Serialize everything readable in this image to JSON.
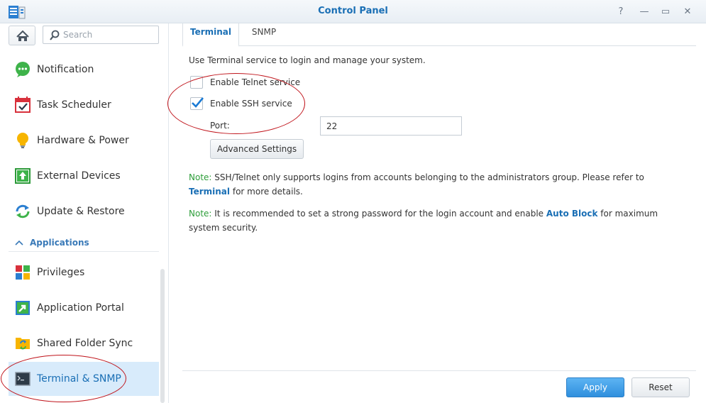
{
  "window": {
    "title": "Control Panel",
    "buttons": [
      {
        "name": "help-icon",
        "glyph": "?"
      },
      {
        "name": "minimize-icon",
        "glyph": "—"
      },
      {
        "name": "maximize-icon",
        "glyph": "▭"
      },
      {
        "name": "close-icon",
        "glyph": "✕"
      }
    ]
  },
  "sidebar": {
    "search_placeholder": "Search",
    "items": [
      {
        "label": "Notification",
        "icon": "notification-icon",
        "active": false
      },
      {
        "label": "Task Scheduler",
        "icon": "task-scheduler-icon",
        "active": false
      },
      {
        "label": "Hardware & Power",
        "icon": "lightbulb-icon",
        "active": false
      },
      {
        "label": "External Devices",
        "icon": "external-device-icon",
        "active": false
      },
      {
        "label": "Update & Restore",
        "icon": "update-restore-icon",
        "active": false
      }
    ],
    "section": {
      "label": "Applications",
      "icon": "chevron-up-icon"
    },
    "app_items": [
      {
        "label": "Privileges",
        "icon": "privileges-icon",
        "active": false
      },
      {
        "label": "Application Portal",
        "icon": "app-portal-icon",
        "active": false
      },
      {
        "label": "Shared Folder Sync",
        "icon": "shared-folder-sync-icon",
        "active": false
      },
      {
        "label": "Terminal & SNMP",
        "icon": "terminal-icon",
        "active": true
      }
    ]
  },
  "main": {
    "tabs": [
      {
        "label": "Terminal",
        "active": true
      },
      {
        "label": "SNMP",
        "active": false
      }
    ],
    "description": "Use Terminal service to login and manage your system.",
    "telnet": {
      "label": "Enable Telnet service",
      "checked": false
    },
    "ssh": {
      "label": "Enable SSH service",
      "checked": true
    },
    "port": {
      "label": "Port:",
      "value": "22"
    },
    "advanced_button": "Advanced Settings",
    "note1": {
      "prefix": "Note:",
      "text_before": " SSH/Telnet only supports logins from accounts belonging to the administrators group. Please refer to ",
      "link": "Terminal",
      "text_after": " for more details."
    },
    "note2": {
      "prefix": "Note:",
      "text_before": " It is recommended to set a strong password for the login account and enable ",
      "link": "Auto Block",
      "text_after": " for maximum system security."
    },
    "apply_button": "Apply",
    "reset_button": "Reset"
  },
  "colors": {
    "accent": "#1a6fb5",
    "note_green": "#2e9e3a",
    "annotation_red": "#c0151c",
    "active_item_bg": "#d8ebfb"
  }
}
